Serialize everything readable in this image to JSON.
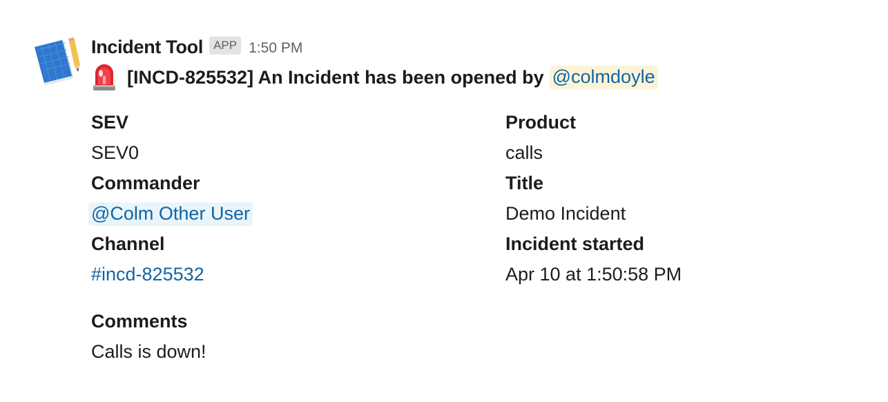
{
  "message": {
    "sender": "Incident Tool",
    "badge": "APP",
    "timestamp": "1:50 PM",
    "avatar_icon": "notebook-pencil-icon",
    "headline": {
      "icon": "rotating-light-icon",
      "text": "[INCD-825532] An Incident has been opened by",
      "mention": "@colmdoyle"
    }
  },
  "fields": {
    "sev": {
      "label": "SEV",
      "value": "SEV0"
    },
    "product": {
      "label": "Product",
      "value": "calls"
    },
    "commander": {
      "label": "Commander",
      "value": "@Colm Other User"
    },
    "title": {
      "label": "Title",
      "value": "Demo Incident"
    },
    "channel": {
      "label": "Channel",
      "value": "#incd-825532"
    },
    "incident_started": {
      "label": "Incident started",
      "value": "Apr 10 at 1:50:58 PM"
    },
    "comments": {
      "label": "Comments",
      "value": "Calls is down!"
    }
  },
  "colors": {
    "link": "#1264a3",
    "mention_highlight": "#fcf4d9",
    "user_mention_bg": "#e8f5fa",
    "text": "#1d1c1d",
    "muted": "#616061"
  }
}
